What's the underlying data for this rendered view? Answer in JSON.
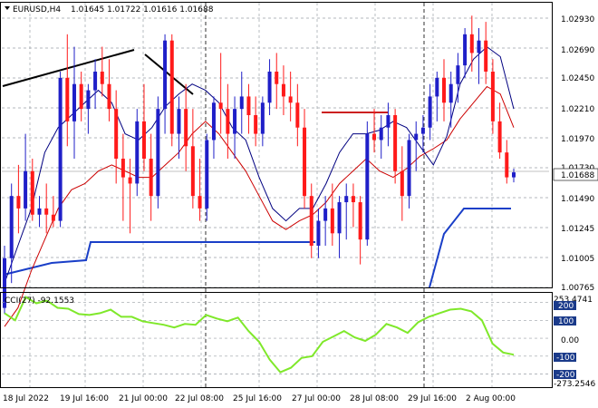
{
  "header": {
    "symbol": "EURUSD,H4",
    "ohlc": "1.01645 1.01722 1.01616 1.01688"
  },
  "price_axis": {
    "labels": [
      "1.02930",
      "1.02690",
      "1.02450",
      "1.02210",
      "1.01970",
      "1.01730",
      "1.01490",
      "1.01245",
      "1.01005",
      "1.00765"
    ],
    "current_price": "1.01688"
  },
  "indicator": {
    "label": "CCI(27) -92.1553",
    "labels": [
      "253.4741",
      "200",
      "100",
      "0.00",
      "-100",
      "-200",
      "-273.2546"
    ]
  },
  "time_axis": {
    "labels": [
      "18 Jul 2022",
      "19 Jul 16:00",
      "21 Jul 00:00",
      "22 Jul 08:00",
      "25 Jul 16:00",
      "27 Jul 00:00",
      "28 Jul 08:00",
      "29 Jul 16:00",
      "2 Aug 00:00"
    ]
  },
  "colors": {
    "bull": "#1f1fc8",
    "bear": "#ff1a1a",
    "ma_fast": "#000080",
    "ma_slow": "#cc0000",
    "cci": "#7fe82a",
    "support": "#1a3fc8",
    "resistance": "#cc2020",
    "trend": "#000000",
    "grid": "#9aa0a6",
    "level_box": "#1a3a8a"
  },
  "chart_data": {
    "type": "candlestick",
    "ohlc_order": "open,high,low,close",
    "ylim": [
      1.00765,
      1.0293
    ],
    "candles": [
      [
        1.006,
        1.011,
        1.0055,
        1.01
      ],
      [
        1.01,
        1.016,
        1.008,
        1.015
      ],
      [
        1.015,
        1.0175,
        1.012,
        1.014
      ],
      [
        1.014,
        1.02,
        1.013,
        1.017
      ],
      [
        1.017,
        1.018,
        1.013,
        1.0135
      ],
      [
        1.0135,
        1.015,
        1.0125,
        1.014
      ],
      [
        1.014,
        1.016,
        1.012,
        1.0135
      ],
      [
        1.0135,
        1.015,
        1.0125,
        1.013
      ],
      [
        1.013,
        1.025,
        1.0125,
        1.0245
      ],
      [
        1.0245,
        1.028,
        1.019,
        1.021
      ],
      [
        1.021,
        1.027,
        1.018,
        1.024
      ],
      [
        1.024,
        1.025,
        1.021,
        1.022
      ],
      [
        1.022,
        1.024,
        1.02,
        1.0235
      ],
      [
        1.0235,
        1.026,
        1.022,
        1.025
      ],
      [
        1.025,
        1.027,
        1.023,
        1.024
      ],
      [
        1.024,
        1.026,
        1.021,
        1.022
      ],
      [
        1.022,
        1.0235,
        1.016,
        1.018
      ],
      [
        1.018,
        1.02,
        1.013,
        1.0165
      ],
      [
        1.0165,
        1.018,
        1.012,
        1.016
      ],
      [
        1.016,
        1.022,
        1.015,
        1.021
      ],
      [
        1.021,
        1.024,
        1.017,
        1.018
      ],
      [
        1.018,
        1.02,
        1.013,
        1.015
      ],
      [
        1.015,
        1.023,
        1.014,
        1.022
      ],
      [
        1.022,
        1.028,
        1.02,
        1.0275
      ],
      [
        1.0275,
        1.028,
        1.019,
        1.02
      ],
      [
        1.02,
        1.023,
        1.018,
        1.022
      ],
      [
        1.022,
        1.024,
        1.017,
        1.019
      ],
      [
        1.019,
        1.022,
        1.014,
        1.015
      ],
      [
        1.015,
        1.018,
        1.013,
        1.014
      ],
      [
        1.014,
        1.02,
        1.013,
        1.0195
      ],
      [
        1.0195,
        1.023,
        1.018,
        1.0225
      ],
      [
        1.0225,
        1.0265,
        1.02,
        1.022
      ],
      [
        1.022,
        1.024,
        1.018,
        1.02
      ],
      [
        1.02,
        1.023,
        1.018,
        1.022
      ],
      [
        1.022,
        1.025,
        1.02,
        1.023
      ],
      [
        1.023,
        1.024,
        1.02,
        1.0215
      ],
      [
        1.0215,
        1.023,
        1.019,
        1.02
      ],
      [
        1.02,
        1.023,
        1.019,
        1.0225
      ],
      [
        1.0225,
        1.026,
        1.0215,
        1.025
      ],
      [
        1.025,
        1.0265,
        1.022,
        1.024
      ],
      [
        1.024,
        1.0255,
        1.0215,
        1.023
      ],
      [
        1.023,
        1.025,
        1.021,
        1.0225
      ],
      [
        1.0225,
        1.024,
        1.019,
        1.0205
      ],
      [
        1.0205,
        1.022,
        1.014,
        1.015
      ],
      [
        1.015,
        1.016,
        1.01,
        1.011
      ],
      [
        1.011,
        1.014,
        1.01,
        1.013
      ],
      [
        1.013,
        1.015,
        1.011,
        1.014
      ],
      [
        1.014,
        1.016,
        1.011,
        1.012
      ],
      [
        1.012,
        1.015,
        1.01,
        1.0145
      ],
      [
        1.0145,
        1.016,
        1.0115,
        1.015
      ],
      [
        1.015,
        1.016,
        1.0125,
        1.0145
      ],
      [
        1.0145,
        1.015,
        1.0095,
        1.0115
      ],
      [
        1.0115,
        1.021,
        1.011,
        1.02
      ],
      [
        1.02,
        1.022,
        1.0185,
        1.0195
      ],
      [
        1.0195,
        1.0215,
        1.018,
        1.0205
      ],
      [
        1.0205,
        1.0225,
        1.019,
        1.0215
      ],
      [
        1.0215,
        1.022,
        1.016,
        1.017
      ],
      [
        1.017,
        1.019,
        1.013,
        1.015
      ],
      [
        1.015,
        1.02,
        1.014,
        1.0195
      ],
      [
        1.0195,
        1.021,
        1.017,
        1.02
      ],
      [
        1.02,
        1.0215,
        1.0185,
        1.0205
      ],
      [
        1.0205,
        1.024,
        1.0195,
        1.023
      ],
      [
        1.023,
        1.025,
        1.021,
        1.0245
      ],
      [
        1.0245,
        1.026,
        1.021,
        1.0225
      ],
      [
        1.0225,
        1.025,
        1.0205,
        1.024
      ],
      [
        1.024,
        1.0265,
        1.0225,
        1.0255
      ],
      [
        1.0255,
        1.0285,
        1.0245,
        1.028
      ],
      [
        1.028,
        1.0295,
        1.025,
        1.0265
      ],
      [
        1.0265,
        1.0285,
        1.024,
        1.0275
      ],
      [
        1.0275,
        1.029,
        1.024,
        1.025
      ],
      [
        1.025,
        1.026,
        1.02,
        1.021
      ],
      [
        1.021,
        1.0225,
        1.018,
        1.0185
      ],
      [
        1.0185,
        1.0195,
        1.016,
        1.0165
      ],
      [
        1.0165,
        1.0172,
        1.0161,
        1.0169
      ]
    ],
    "ma_fast": [
      1.008,
      1.011,
      1.014,
      1.0185,
      1.0205,
      1.0215,
      1.0225,
      1.0235,
      1.0225,
      1.02,
      1.0195,
      1.0205,
      1.0222,
      1.0232,
      1.024,
      1.0235,
      1.0225,
      1.0205,
      1.0195,
      1.0165,
      1.014,
      1.013,
      1.014,
      1.014,
      1.016,
      1.0185,
      1.02,
      1.02,
      1.0203,
      1.021,
      1.0205,
      1.019,
      1.0175,
      1.0198,
      1.024,
      1.026,
      1.027,
      1.0262,
      1.022
    ],
    "ma_slow": [
      1.0045,
      1.006,
      1.009,
      1.0115,
      1.014,
      1.0155,
      1.016,
      1.017,
      1.0175,
      1.017,
      1.0165,
      1.0165,
      1.0175,
      1.0185,
      1.02,
      1.021,
      1.02,
      1.0185,
      1.017,
      1.015,
      1.013,
      1.0123,
      1.013,
      1.0135,
      1.0145,
      1.016,
      1.017,
      1.018,
      1.017,
      1.0165,
      1.0172,
      1.0182,
      1.0188,
      1.0195,
      1.0212,
      1.0225,
      1.0238,
      1.0232,
      1.0205
    ],
    "cci": [
      140,
      100,
      230,
      195,
      210,
      170,
      165,
      135,
      130,
      140,
      160,
      120,
      120,
      95,
      85,
      75,
      60,
      80,
      75,
      130,
      110,
      95,
      115,
      40,
      -20,
      -120,
      -190,
      -165,
      -110,
      -100,
      -20,
      10,
      40,
      5,
      -15,
      20,
      80,
      60,
      30,
      90,
      120,
      140,
      160,
      165,
      150,
      100,
      -30,
      -80,
      -92
    ],
    "indicator_ylim": [
      -273.2546,
      253.4741
    ]
  }
}
